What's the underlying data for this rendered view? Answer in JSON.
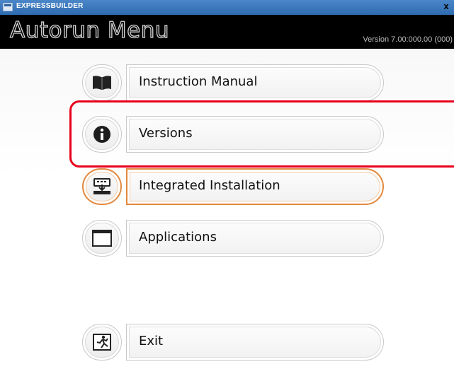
{
  "window": {
    "title": "EXPRESSBUILDER",
    "close_glyph": "x"
  },
  "header": {
    "title": "Autorun Menu",
    "version": "Version 7.00:000.00 (000)"
  },
  "menu": {
    "items": [
      {
        "label": "Instruction Manual",
        "icon": "book-icon",
        "state": "normal"
      },
      {
        "label": "Versions",
        "icon": "info-icon",
        "state": "normal",
        "highlighted": true
      },
      {
        "label": "Integrated Installation",
        "icon": "install-icon",
        "state": "active"
      },
      {
        "label": "Applications",
        "icon": "window-icon",
        "state": "normal"
      },
      {
        "label": "Exit",
        "icon": "exit-icon",
        "state": "normal"
      }
    ]
  },
  "colors": {
    "header_bg": "#000000",
    "active_outline": "#e2893f",
    "highlight_box": "#e8001c",
    "titlebar": "#2f6bb0"
  }
}
